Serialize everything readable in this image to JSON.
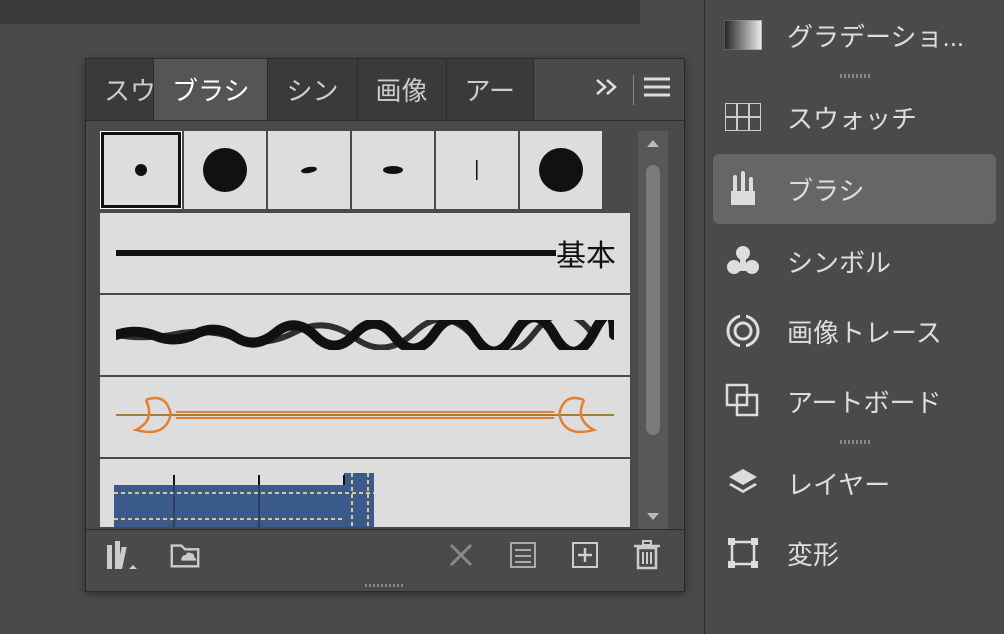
{
  "panel": {
    "tabs": [
      {
        "label": "スウ"
      },
      {
        "label": "ブラシ",
        "active": true
      },
      {
        "label": "シン"
      },
      {
        "label": "画像"
      },
      {
        "label": "アー"
      }
    ],
    "brush_rows": {
      "basic_label": "基本"
    }
  },
  "sidebar": {
    "items": [
      {
        "label": "グラデーショ...",
        "icon": "gradient-icon"
      },
      {
        "label": "スウォッチ",
        "icon": "swatches-icon"
      },
      {
        "label": "ブラシ",
        "icon": "brushes-icon",
        "active": true
      },
      {
        "label": "シンボル",
        "icon": "symbols-icon"
      },
      {
        "label": "画像トレース",
        "icon": "image-trace-icon"
      },
      {
        "label": "アートボード",
        "icon": "artboards-icon"
      },
      {
        "label": "レイヤー",
        "icon": "layers-icon"
      },
      {
        "label": "変形",
        "icon": "transform-icon"
      }
    ]
  }
}
